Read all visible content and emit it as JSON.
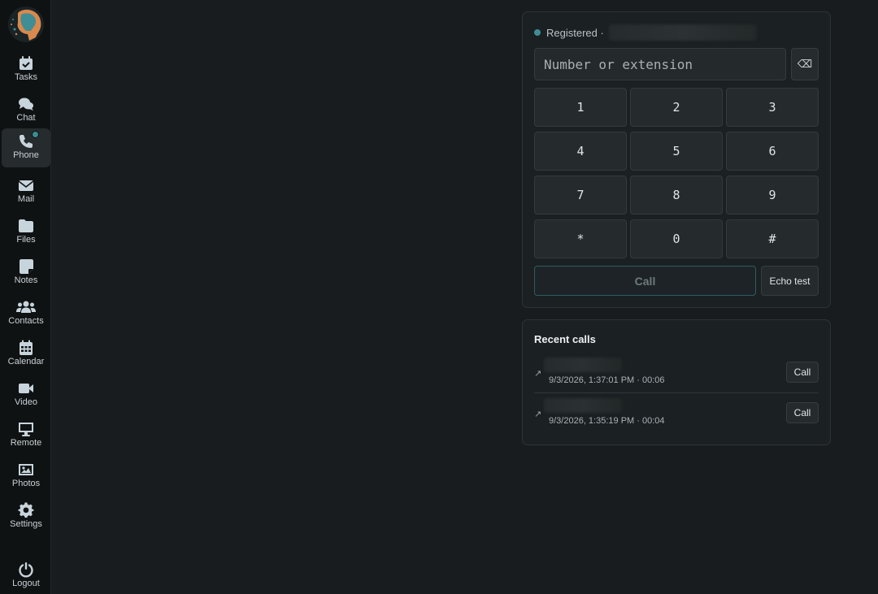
{
  "sidebar": {
    "items": [
      {
        "name": "tasks",
        "label": "Tasks",
        "icon": "calendar-check-icon"
      },
      {
        "name": "chat",
        "label": "Chat",
        "icon": "chat-bubbles-icon"
      },
      {
        "name": "phone",
        "label": "Phone",
        "icon": "phone-icon",
        "active": true
      },
      {
        "name": "mail",
        "label": "Mail",
        "icon": "envelope-icon"
      },
      {
        "name": "files",
        "label": "Files",
        "icon": "folder-icon"
      },
      {
        "name": "notes",
        "label": "Notes",
        "icon": "sticky-note-icon"
      },
      {
        "name": "contacts",
        "label": "Contacts",
        "icon": "users-icon"
      },
      {
        "name": "calendar",
        "label": "Calendar",
        "icon": "calendar-icon"
      },
      {
        "name": "video",
        "label": "Video",
        "icon": "video-camera-icon"
      },
      {
        "name": "remote",
        "label": "Remote",
        "icon": "monitor-icon"
      },
      {
        "name": "photos",
        "label": "Photos",
        "icon": "image-icon"
      },
      {
        "name": "settings",
        "label": "Settings",
        "icon": "gear-icon"
      }
    ],
    "logout_label": "Logout"
  },
  "dialer": {
    "status_text": "Registered · ",
    "status_color": "#3f8d95",
    "input_placeholder": "Number or extension",
    "backspace_symbol": "⌫",
    "keys": [
      "1",
      "2",
      "3",
      "4",
      "5",
      "6",
      "7",
      "8",
      "9",
      "*",
      "0",
      "#"
    ],
    "call_label": "Call",
    "echo_label": "Echo test"
  },
  "recent": {
    "title": "Recent calls",
    "rows": [
      {
        "direction": "↗",
        "meta": "9/3/2026, 1:37:01 PM · 00:06",
        "call_label": "Call"
      },
      {
        "direction": "↗",
        "meta": "9/3/2026, 1:35:19 PM · 00:04",
        "call_label": "Call"
      }
    ]
  }
}
